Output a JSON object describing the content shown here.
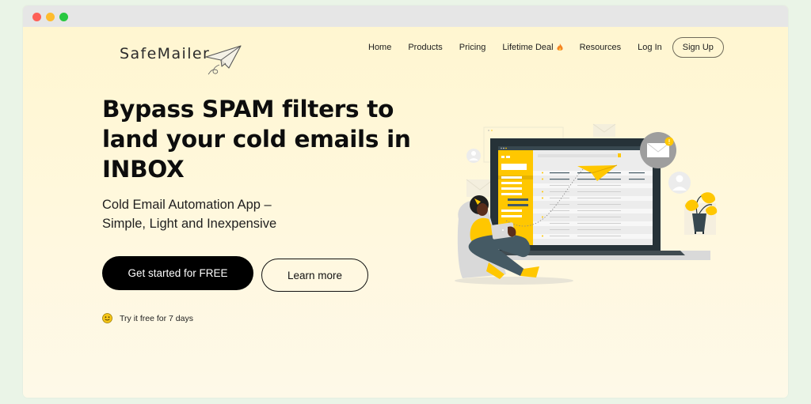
{
  "window": {
    "controls": [
      "close",
      "minimize",
      "maximize"
    ],
    "colors": {
      "close": "#fe5f57",
      "minimize": "#febc2e",
      "maximize": "#28c840"
    }
  },
  "brand": {
    "name": "SafeMailer",
    "logo_icon": "paper-plane-icon"
  },
  "nav": {
    "items": [
      {
        "label": "Home"
      },
      {
        "label": "Products"
      },
      {
        "label": "Pricing"
      },
      {
        "label": "Lifetime Deal",
        "icon": "flame-icon"
      },
      {
        "label": "Resources"
      },
      {
        "label": "Log In"
      }
    ],
    "signup_label": "Sign Up"
  },
  "hero": {
    "title": "Bypass SPAM filters to land your cold emails in INBOX",
    "subtitle_line1": "Cold Email Automation App –",
    "subtitle_line2": "Simple, Light and Inexpensive",
    "primary_cta": "Get started for FREE",
    "secondary_cta": "Learn more",
    "trial_icon": "smiley-icon",
    "trial_text": "Try it free for 7 days"
  },
  "illustration": {
    "description": "woman-with-tablet-laptop-inbox-paper-plane",
    "accent_color": "#ffc700",
    "dark_color": "#263238"
  },
  "colors": {
    "page_bg": "#eaf4e7",
    "hero_bg": "#fff6cf",
    "titlebar": "#e6e6e6",
    "primary_button": "#000000",
    "accent": "#ffc700"
  }
}
